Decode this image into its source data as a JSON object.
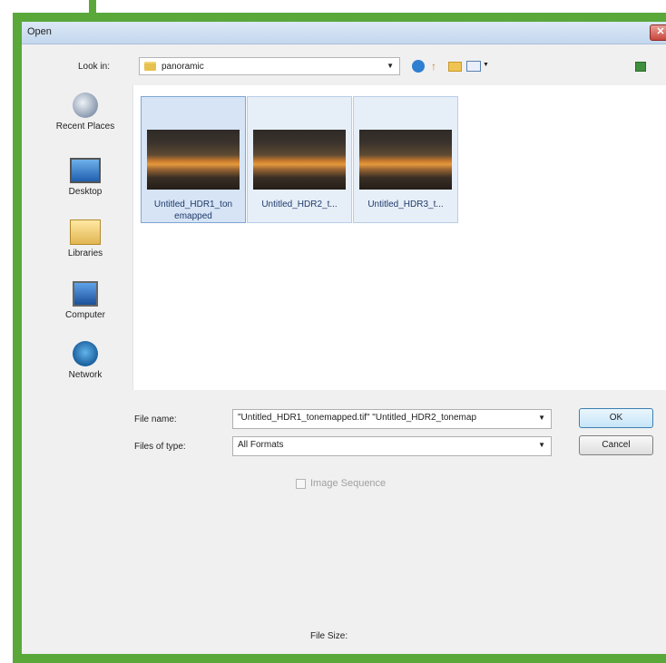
{
  "dialog": {
    "title": "Open",
    "close_glyph": "✕"
  },
  "toolbar": {
    "look_in_label": "Look in:",
    "look_in_value": "panoramic",
    "icons": [
      "back-icon",
      "up-folder-icon",
      "new-folder-icon",
      "views-menu-icon"
    ]
  },
  "places": [
    {
      "label": "Recent Places",
      "icon": "recent-places-icon"
    },
    {
      "label": "Desktop",
      "icon": "desktop-icon"
    },
    {
      "label": "Libraries",
      "icon": "libraries-icon"
    },
    {
      "label": "Computer",
      "icon": "computer-icon"
    },
    {
      "label": "Network",
      "icon": "network-icon"
    }
  ],
  "files": [
    {
      "name": "Untitled_HDR1_ton emapped",
      "selected": true
    },
    {
      "name": "Untitled_HDR2_t...",
      "selected": false
    },
    {
      "name": "Untitled_HDR3_t...",
      "selected": false
    }
  ],
  "form": {
    "file_name_label": "File name:",
    "file_name_value": "\"Untitled_HDR1_tonemapped.tif\" \"Untitled_HDR2_tonemap",
    "files_of_type_label": "Files of type:",
    "files_of_type_value": "All Formats",
    "ok_label": "OK",
    "cancel_label": "Cancel"
  },
  "options": {
    "image_sequence_label": "Image Sequence",
    "image_sequence_checked": false,
    "file_size_label": "File Size:"
  },
  "colors": {
    "frame_green": "#5aa83a",
    "selection_blue": "#d6e4f5"
  }
}
